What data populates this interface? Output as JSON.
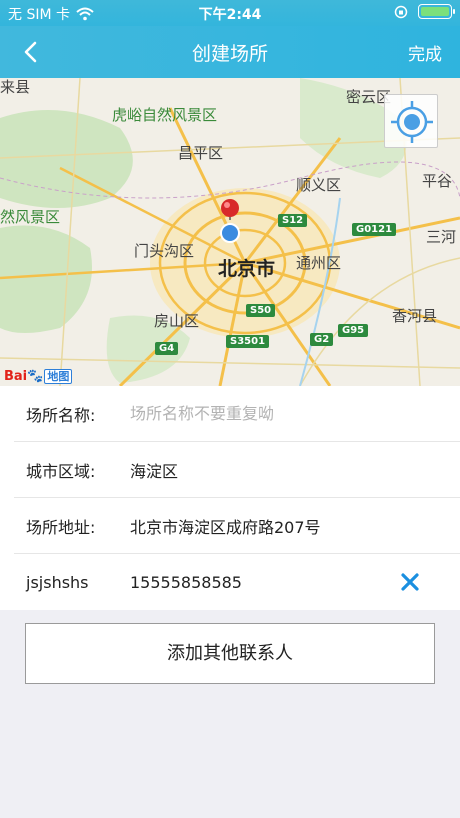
{
  "status_bar": {
    "carrier": "无 SIM 卡",
    "time": "下午2:44"
  },
  "nav": {
    "title": "创建场所",
    "done_label": "完成"
  },
  "map": {
    "labels": {
      "hushan": "虎峪自然风景区",
      "miyun": "密云区",
      "changping": "昌平区",
      "shunyi": "顺义区",
      "pinggu": "平谷",
      "fengjing": "然风景区",
      "mentougou": "门头沟区",
      "beijing": "北京市",
      "tongzhou": "通州区",
      "sanhe": "三河",
      "fangshan": "房山区",
      "xianghe": "香河县",
      "laishui": "来县"
    },
    "shields": {
      "s12": "S12",
      "g0121": "G0121",
      "s50": "S50",
      "g4": "G4",
      "s3501": "S3501",
      "g2": "G2",
      "g95": "G95"
    },
    "logo_text": "Bai",
    "logo_map": "地图"
  },
  "form": {
    "name_label": "场所名称:",
    "name_placeholder": "场所名称不要重复呦",
    "region_label": "城市区域:",
    "region_value": "海淀区",
    "address_label": "场所地址:",
    "address_value": "北京市海淀区成府路207号",
    "contact_name": "jsjshshs",
    "contact_phone": "15555858585"
  },
  "add_contact_label": "添加其他联系人",
  "colors": {
    "header": "#35b6dc",
    "delete_icon": "#1a8fe0"
  }
}
